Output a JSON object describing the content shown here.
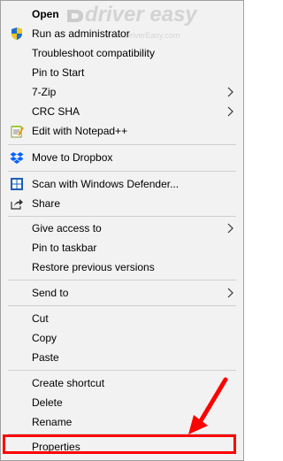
{
  "watermark": {
    "brand": "driver easy",
    "url": "www.DriverEasy.com"
  },
  "menu": {
    "items": [
      {
        "label": "Open",
        "bold": true
      },
      {
        "label": "Run as administrator",
        "icon": "uac-shield-icon"
      },
      {
        "label": "Troubleshoot compatibility"
      },
      {
        "label": "Pin to Start"
      },
      {
        "label": "7-Zip",
        "submenu": true
      },
      {
        "label": "CRC SHA",
        "submenu": true
      },
      {
        "label": "Edit with Notepad++",
        "icon": "notepad-plus-plus-icon"
      },
      {
        "label": "Move to Dropbox",
        "icon": "dropbox-icon"
      },
      {
        "label": "Scan with Windows Defender...",
        "icon": "windows-defender-icon"
      },
      {
        "label": "Share",
        "icon": "share-icon"
      },
      {
        "label": "Give access to",
        "submenu": true
      },
      {
        "label": "Pin to taskbar"
      },
      {
        "label": "Restore previous versions"
      },
      {
        "label": "Send to",
        "submenu": true
      },
      {
        "label": "Cut"
      },
      {
        "label": "Copy"
      },
      {
        "label": "Paste"
      },
      {
        "label": "Create shortcut"
      },
      {
        "label": "Delete"
      },
      {
        "label": "Rename"
      },
      {
        "label": "Properties",
        "highlighted": true
      }
    ]
  },
  "colors": {
    "annotation": "#ff0000",
    "menu_bg": "#f2f2f2",
    "separator": "#cfcfcf"
  }
}
